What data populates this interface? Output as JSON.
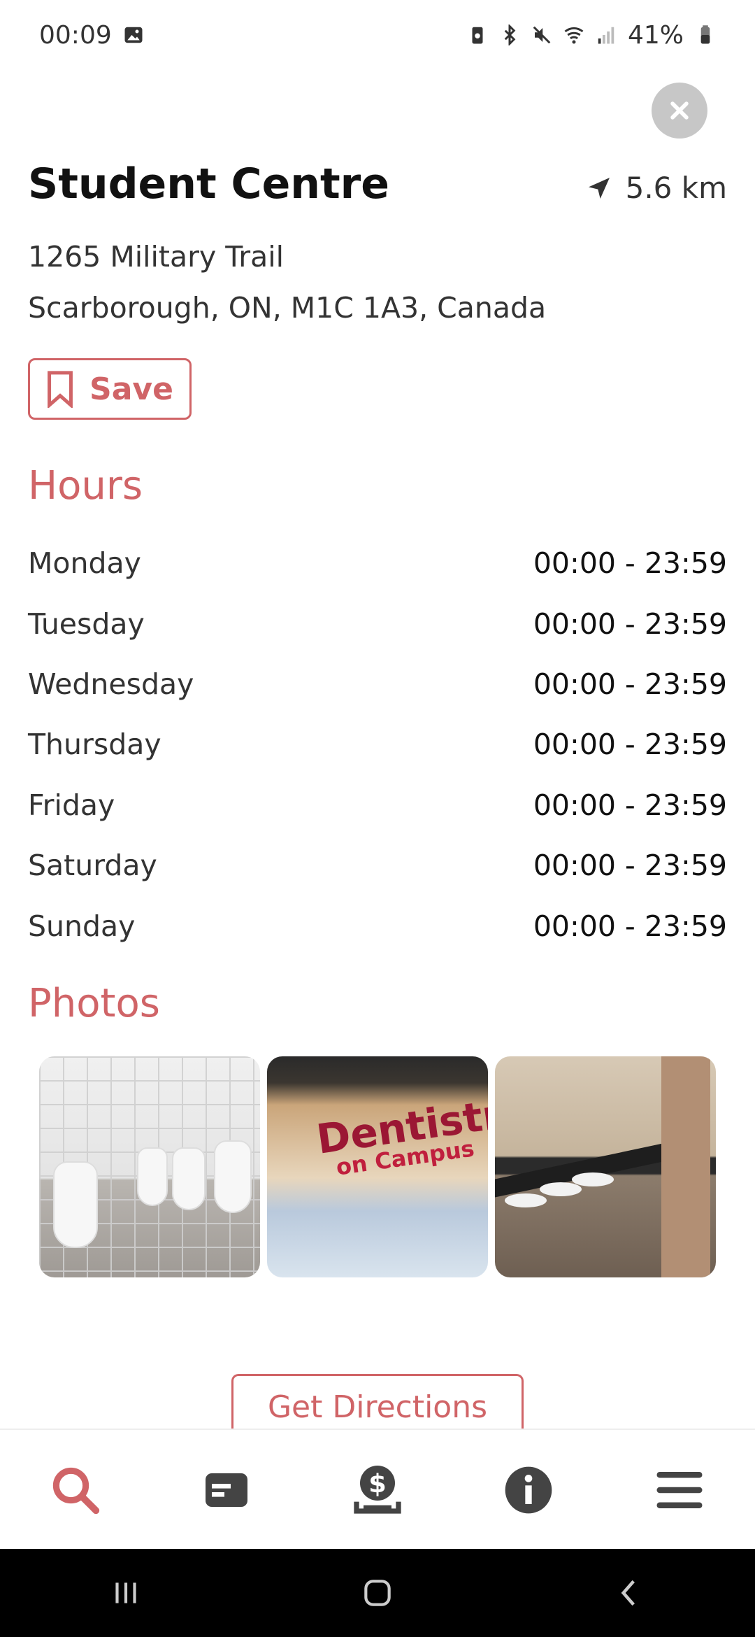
{
  "status_bar": {
    "time": "00:09",
    "battery": "41%",
    "icons": [
      "image-icon",
      "battery-saver-icon",
      "bluetooth-icon",
      "mute-icon",
      "wifi-icon",
      "signal-icon",
      "battery-icon"
    ]
  },
  "place": {
    "name": "Student Centre",
    "distance": "5.6 km",
    "address_line1": "1265 Military Trail",
    "address_line2": "Scarborough,  ON, M1C 1A3, Canada"
  },
  "actions": {
    "save_label": "Save",
    "directions_label": "Get Directions"
  },
  "hours": {
    "title": "Hours",
    "rows": [
      {
        "day": "Monday",
        "time": "00:00 - 23:59"
      },
      {
        "day": "Tuesday",
        "time": "00:00 - 23:59"
      },
      {
        "day": "Wednesday",
        "time": "00:00 - 23:59"
      },
      {
        "day": "Thursday",
        "time": "00:00 - 23:59"
      },
      {
        "day": "Friday",
        "time": "00:00 - 23:59"
      },
      {
        "day": "Saturday",
        "time": "00:00 - 23:59"
      },
      {
        "day": "Sunday",
        "time": "00:00 - 23:59"
      }
    ]
  },
  "photos": {
    "title": "Photos",
    "sign_line1": "Dentistry",
    "sign_line2": "on Campus"
  },
  "tabbar": {
    "items": [
      "search-icon",
      "card-icon",
      "money-icon",
      "info-icon",
      "menu-icon"
    ],
    "active_color": "#d06467",
    "inactive_color": "#444444"
  },
  "colors": {
    "accent": "#d06467"
  }
}
